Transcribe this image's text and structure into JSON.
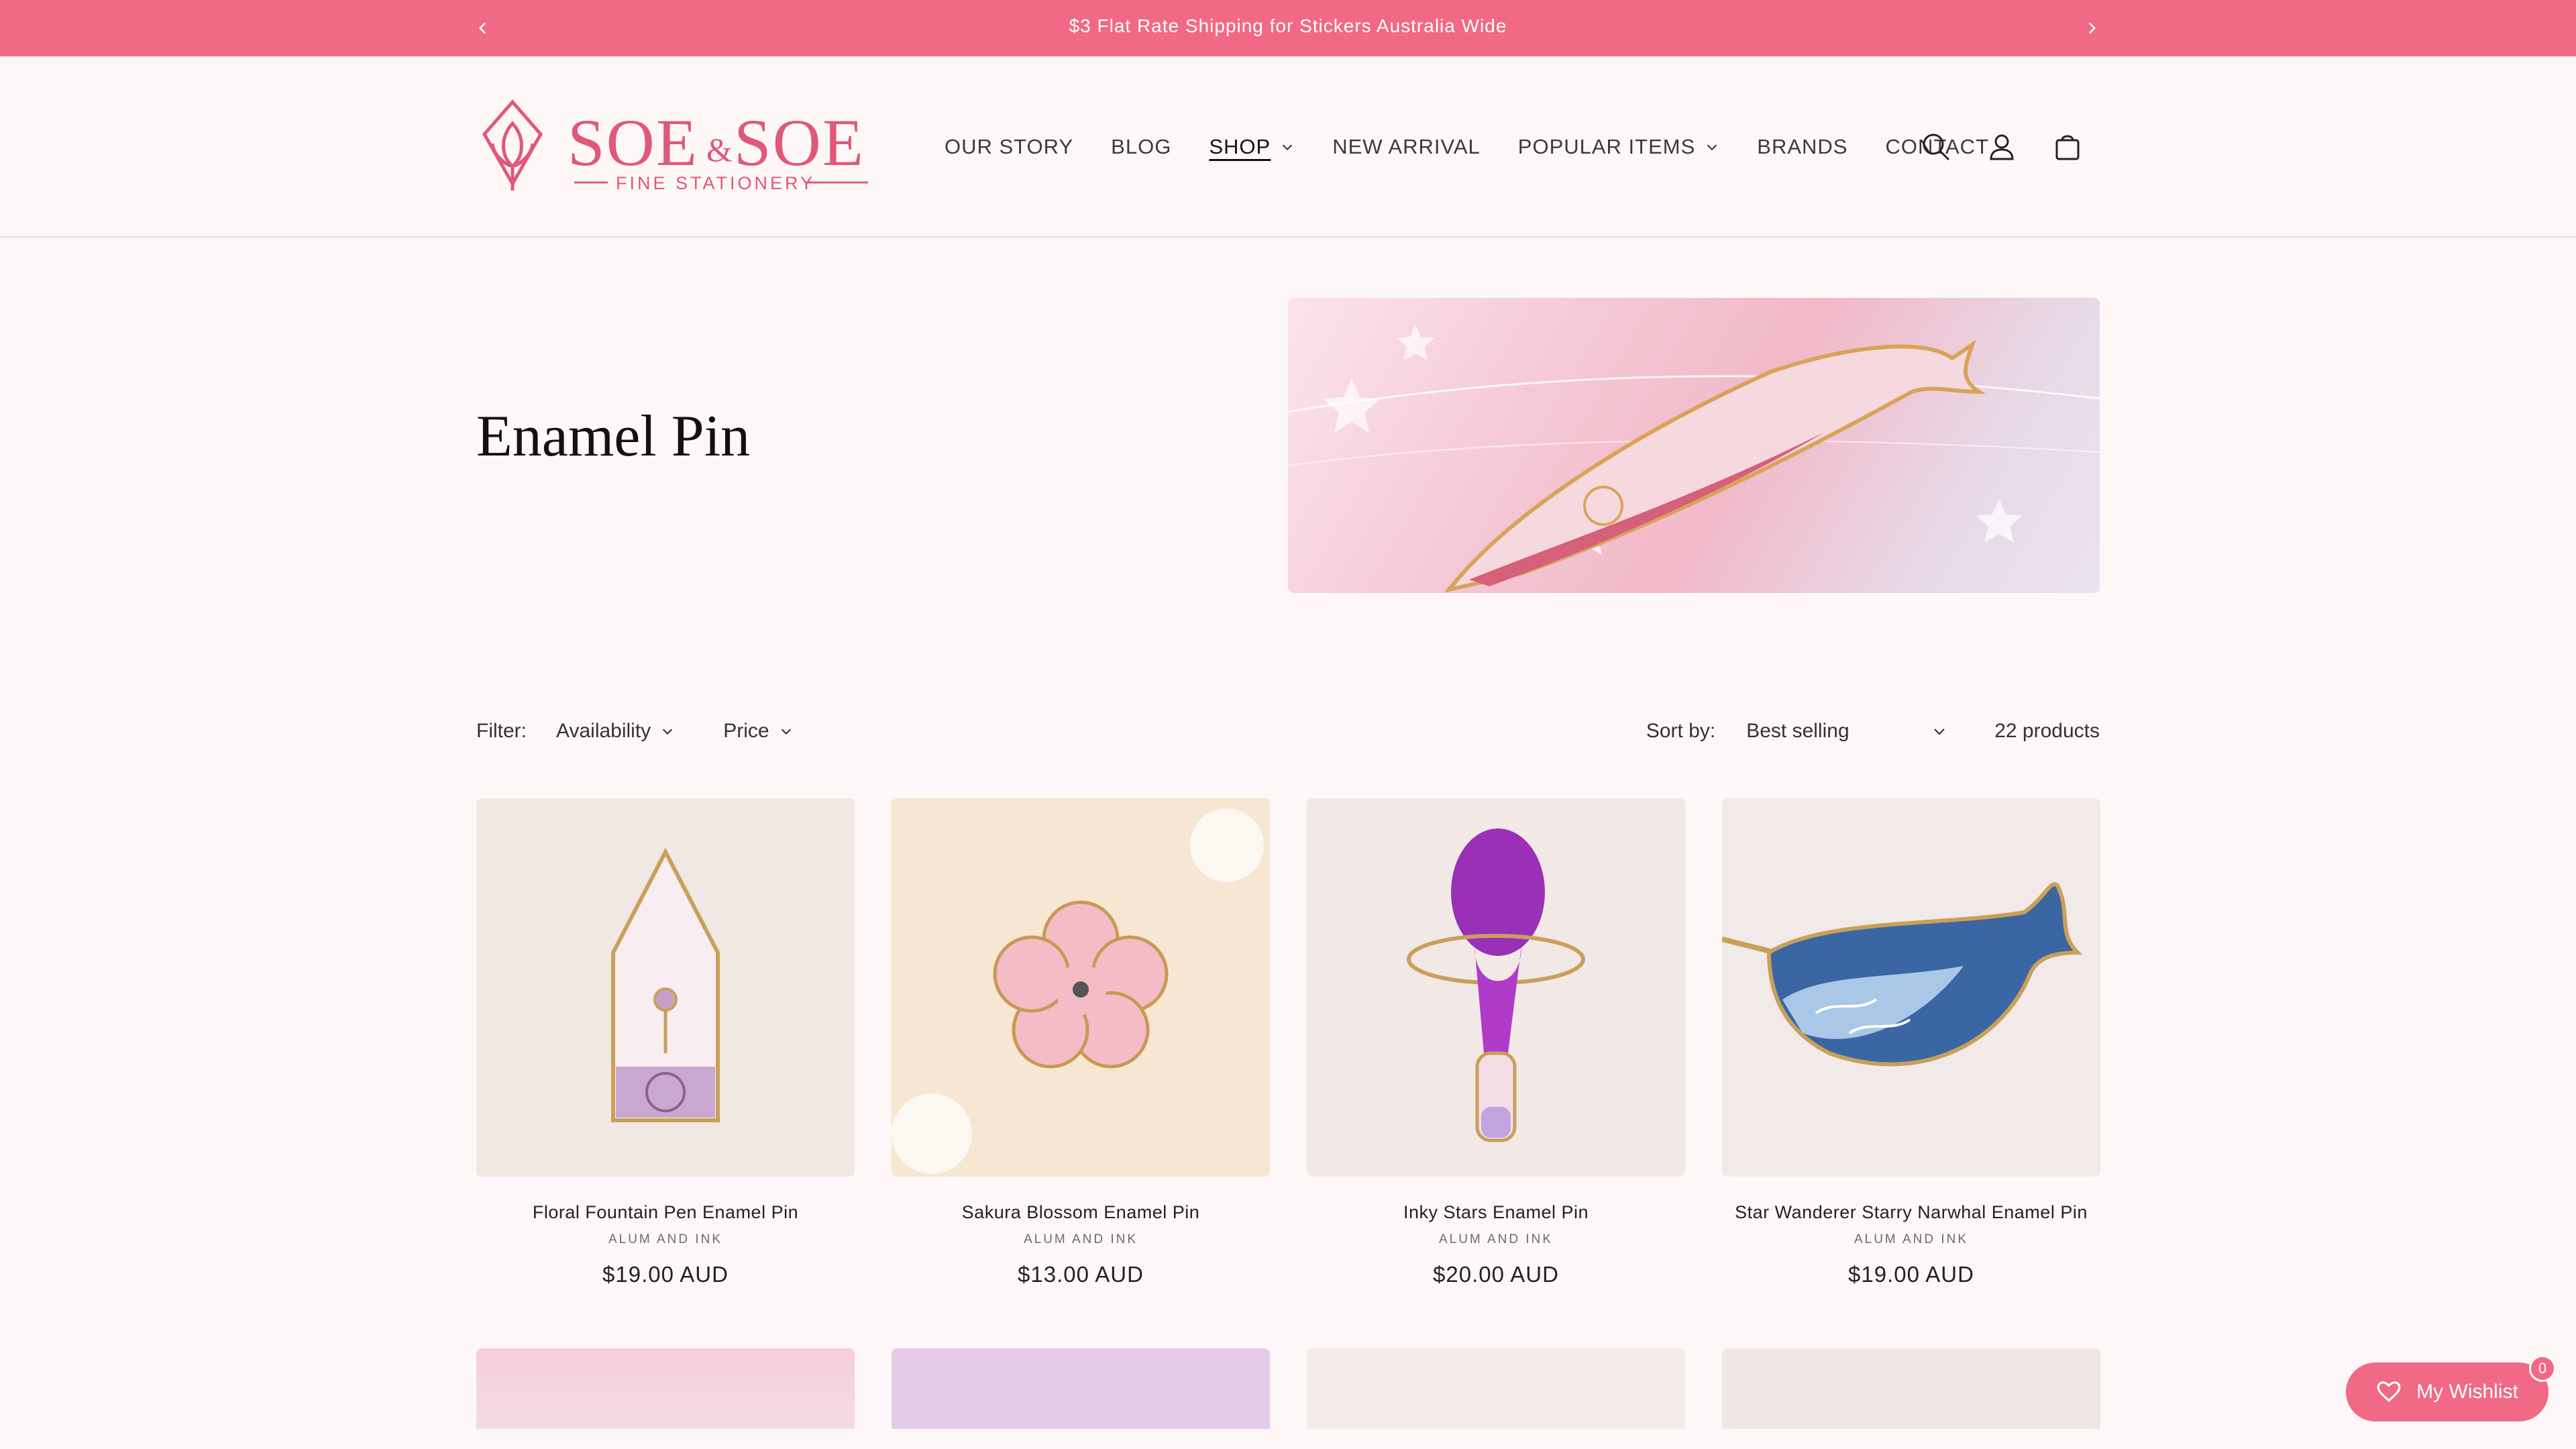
{
  "announcement": {
    "text": "$3 Flat Rate Shipping for Stickers Australia Wide"
  },
  "brand": {
    "name": "SOE & SOE",
    "tagline": "FINE STATIONERY",
    "color": "#e0587a"
  },
  "nav": {
    "items": [
      {
        "label": "OUR STORY",
        "dropdown": false
      },
      {
        "label": "BLOG",
        "dropdown": false
      },
      {
        "label": "SHOP",
        "dropdown": true,
        "active": true
      },
      {
        "label": "NEW ARRIVAL",
        "dropdown": false
      },
      {
        "label": "POPULAR ITEMS",
        "dropdown": true
      },
      {
        "label": "BRANDS",
        "dropdown": false
      },
      {
        "label": "CONTACT",
        "dropdown": false
      }
    ],
    "icons": [
      "search-icon",
      "account-icon",
      "cart-icon"
    ]
  },
  "collection": {
    "title": "Enamel Pin"
  },
  "filters": {
    "label": "Filter:",
    "availability": "Availability",
    "price": "Price",
    "sort_label": "Sort by:",
    "sort_value": "Best selling",
    "count": "22 products"
  },
  "products": [
    {
      "title": "Floral Fountain Pen Enamel Pin",
      "vendor": "ALUM AND INK",
      "price": "$19.00 AUD"
    },
    {
      "title": "Sakura Blossom Enamel Pin",
      "vendor": "ALUM AND INK",
      "price": "$13.00 AUD"
    },
    {
      "title": "Inky Stars Enamel Pin",
      "vendor": "ALUM AND INK",
      "price": "$20.00 AUD"
    },
    {
      "title": "Star Wanderer Starry Narwhal Enamel Pin",
      "vendor": "ALUM AND INK",
      "price": "$19.00 AUD"
    }
  ],
  "wishlist": {
    "label": "My Wishlist",
    "count": "0"
  },
  "colors": {
    "accent": "#f16984",
    "background": "#fdf7f8"
  }
}
